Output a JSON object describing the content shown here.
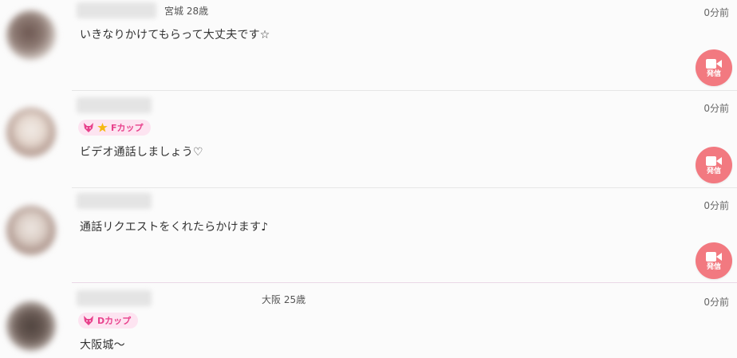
{
  "colors": {
    "call_button": "#f27980",
    "badge_bg": "#fde4f1",
    "badge_text": "#e8418c"
  },
  "items": [
    {
      "location_age": "宮城 28歳",
      "time": "0分前",
      "message": "いきなりかけてもらって大丈夫です☆",
      "call_label": "発信",
      "badge": null
    },
    {
      "location_age": "",
      "time": "0分前",
      "message": "ビデオ通話しましょう♡",
      "call_label": "発信",
      "badge": {
        "icons": [
          "fox-icon",
          "star-icon"
        ],
        "text": "Fカップ"
      }
    },
    {
      "location_age": "",
      "time": "0分前",
      "message": "通話リクエストをくれたらかけます♪",
      "call_label": "発信",
      "badge": null
    },
    {
      "location_age": "大阪 25歳",
      "time": "0分前",
      "message": "大阪城〜",
      "call_label": "",
      "badge": {
        "icons": [
          "fox-icon"
        ],
        "text": "Dカップ"
      }
    }
  ]
}
